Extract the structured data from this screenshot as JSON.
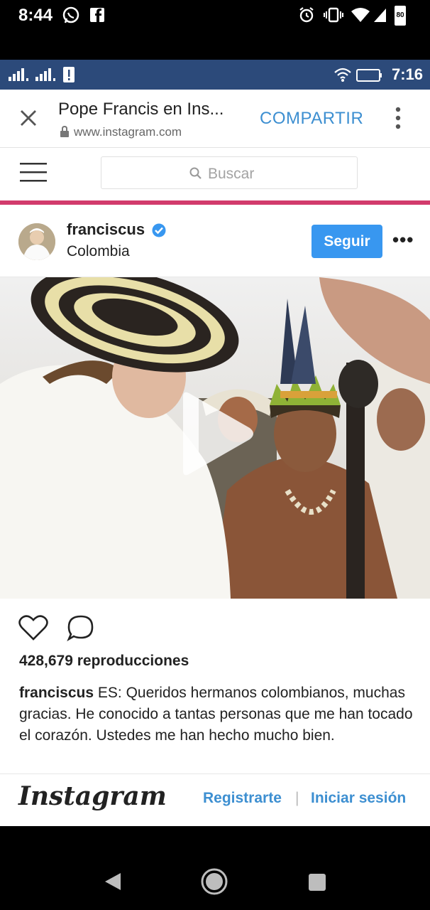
{
  "outer_status": {
    "time": "8:44",
    "battery_level": "80",
    "icons": [
      "whatsapp-icon",
      "facebook-icon",
      "alarm-icon",
      "vibrate-icon",
      "wifi-icon",
      "signal-icon",
      "battery-icon"
    ]
  },
  "inner_status": {
    "time": "7:16",
    "icons": [
      "signal-icon",
      "signal-icon",
      "alert-icon",
      "wifi-icon",
      "battery-icon"
    ]
  },
  "tab": {
    "title": "Pope Francis en Ins...",
    "url": "www.instagram.com",
    "share_label": "COMPARTIR"
  },
  "search": {
    "placeholder": "Buscar"
  },
  "post": {
    "username": "franciscus",
    "location": "Colombia",
    "follow_label": "Seguir",
    "more_label": "•••",
    "views": "428,679 reproducciones",
    "caption_user": "franciscus",
    "caption_text": "ES: Queridos hermanos colombianos, muchas gracias. He conocido a tantas personas que me han tocado el corazón. Ustedes me han hecho mucho bien."
  },
  "ig_bar": {
    "logo": "Instagram",
    "register_label": "Registrarte",
    "separator": "|",
    "login_label": "Iniciar sesión"
  },
  "colors": {
    "accent": "#3897f0",
    "link": "#3d8fd1",
    "pink_bar": "#d23b6c",
    "inner_status": "#2c4a7a"
  }
}
